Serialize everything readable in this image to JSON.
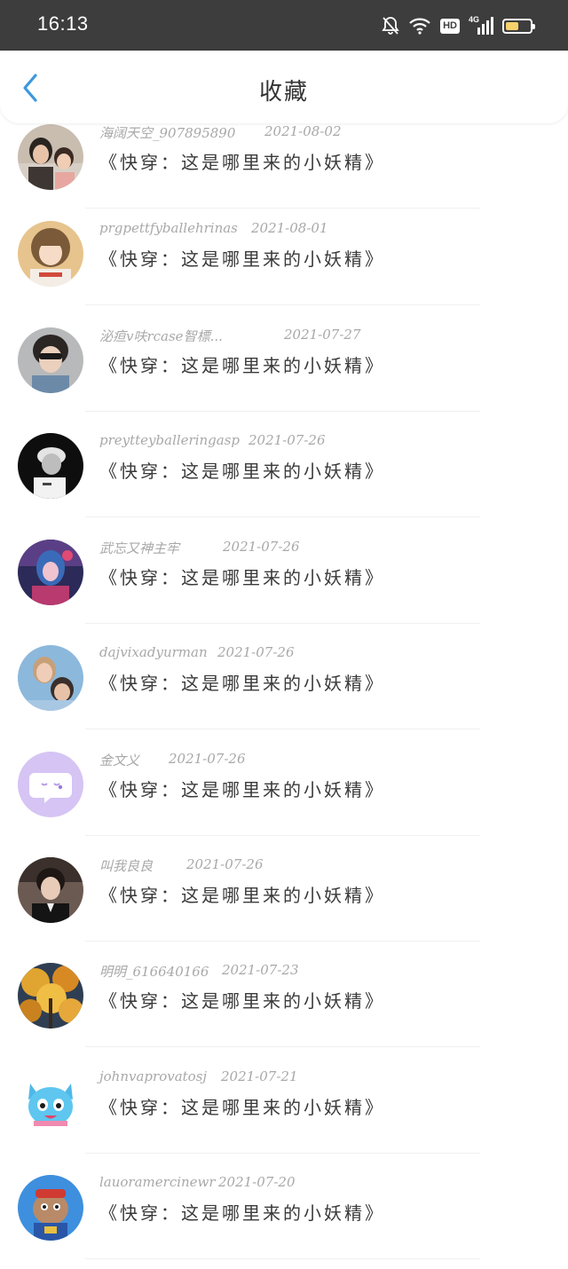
{
  "status_bar": {
    "time": "16:13",
    "hd_label": "HD",
    "network_label": "4G",
    "battery_level": 0.55,
    "icons": [
      "bell-off-icon",
      "wifi-icon",
      "hd-icon",
      "signal-4g-icon",
      "battery-icon"
    ]
  },
  "nav": {
    "back_icon": "chevron-left-icon",
    "title": "收藏",
    "accent": "#3a98e0"
  },
  "favorites": [
    {
      "name": "海阔天空_907895890",
      "date": "2021-08-02",
      "content": "《快穿：这是哪里来的小妖精》",
      "avatar": "photo-couple-child"
    },
    {
      "name": "prgpettfyballehrinas",
      "date": "2021-08-01",
      "content": "《快穿：这是哪里来的小妖精》",
      "avatar": "photo-girl-bangs"
    },
    {
      "name": "泌疸v呋rcase智標...",
      "date": "2021-07-27",
      "content": "《快穿：这是哪里来的小妖精》",
      "avatar": "photo-boy-sunglasses"
    },
    {
      "name": "preytteyballeringasp",
      "date": "2021-07-26",
      "content": "《快穿：这是哪里来的小妖精》",
      "avatar": "photo-bw-cap"
    },
    {
      "name": "武忘又神主牢",
      "date": "2021-07-26",
      "content": "《快穿：这是哪里来的小妖精》",
      "avatar": "photo-game-character"
    },
    {
      "name": "dajvixadyurman",
      "date": "2021-07-26",
      "content": "《快穿：这是哪里来的小妖精》",
      "avatar": "photo-two-men"
    },
    {
      "name": "金文义",
      "date": "2021-07-26",
      "content": "《快穿：这是哪里来的小妖精》",
      "avatar": "chat-bubble-default"
    },
    {
      "name": "叫我良良",
      "date": "2021-07-26",
      "content": "《快穿：这是哪里来的小妖精》",
      "avatar": "photo-man-suit"
    },
    {
      "name": "明明_616640166",
      "date": "2021-07-23",
      "content": "《快穿：这是哪里来的小妖精》",
      "avatar": "photo-autumn-trees"
    },
    {
      "name": "johnvaprovatosj",
      "date": "2021-07-21",
      "content": "《快穿：这是哪里来的小妖精》",
      "avatar": "cartoon-blue-cat"
    },
    {
      "name": "lauoramercinewr",
      "date": "2021-07-20",
      "content": "《快穿：这是哪里来的小妖精》",
      "avatar": "cartoon-character-blue"
    }
  ]
}
